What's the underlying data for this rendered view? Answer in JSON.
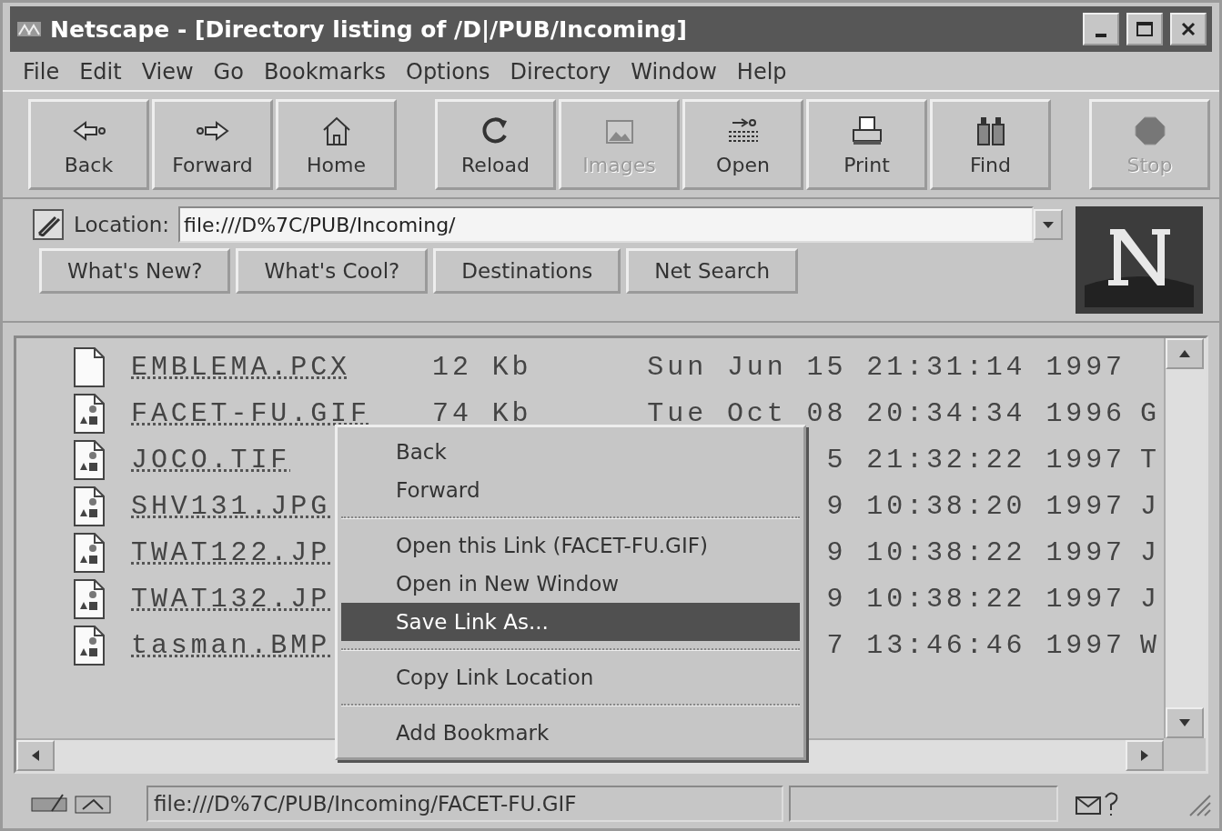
{
  "window": {
    "title": "Netscape - [Directory listing of /D|/PUB/Incoming]"
  },
  "menu_bar": [
    "File",
    "Edit",
    "View",
    "Go",
    "Bookmarks",
    "Options",
    "Directory",
    "Window",
    "Help"
  ],
  "toolbar": {
    "groups": [
      [
        {
          "kind": "back",
          "label": "Back",
          "disabled": false
        },
        {
          "kind": "forward",
          "label": "Forward",
          "disabled": false
        },
        {
          "kind": "home",
          "label": "Home",
          "disabled": false
        }
      ],
      [
        {
          "kind": "reload",
          "label": "Reload",
          "disabled": false
        },
        {
          "kind": "images",
          "label": "Images",
          "disabled": true
        },
        {
          "kind": "open",
          "label": "Open",
          "disabled": false
        },
        {
          "kind": "print",
          "label": "Print",
          "disabled": false
        },
        {
          "kind": "find",
          "label": "Find",
          "disabled": false
        }
      ],
      [
        {
          "kind": "stop",
          "label": "Stop",
          "disabled": true
        }
      ]
    ]
  },
  "location": {
    "label": "Location:",
    "value": "file:///D%7C/PUB/Incoming/"
  },
  "directory_buttons": [
    "What's New?",
    "What's Cool?",
    "Destinations",
    "Net Search"
  ],
  "listing": {
    "rows": [
      {
        "kind": "file",
        "name": "EMBLEMA.PCX",
        "size": "12 Kb",
        "modified": "Sun Jun 15 21:31:14 1997"
      },
      {
        "kind": "image",
        "name": "FACET-FU.GIF",
        "size": "74 Kb",
        "modified": "Tue Oct 08 20:34:34 1996",
        "type": "G"
      },
      {
        "kind": "image",
        "name": "JOCO.TIF",
        "modified": "5 21:32:22 1997",
        "type": "T"
      },
      {
        "kind": "image",
        "name": "SHV131.JPG",
        "modified": "9 10:38:20 1997",
        "type": "J"
      },
      {
        "kind": "image",
        "name": "TWAT122.JP",
        "modified": "9 10:38:22 1997",
        "type": "J"
      },
      {
        "kind": "image",
        "name": "TWAT132.JP",
        "modified": "9 10:38:22 1997",
        "type": "J"
      },
      {
        "kind": "image",
        "name": "tasman.BMP",
        "modified": "7 13:46:46 1997",
        "type": "W"
      }
    ]
  },
  "context_menu": {
    "groups": [
      [
        {
          "label": "Back",
          "selected": false
        },
        {
          "label": "Forward",
          "selected": false
        }
      ],
      [
        {
          "label": "Open this Link (FACET-FU.GIF)",
          "selected": false
        },
        {
          "label": "Open in New Window",
          "selected": false
        },
        {
          "label": "Save Link As...",
          "selected": true
        }
      ],
      [
        {
          "label": "Copy Link Location",
          "selected": false
        }
      ],
      [
        {
          "label": "Add Bookmark",
          "selected": false
        }
      ]
    ]
  },
  "status_bar": {
    "text": "file:///D%7C/PUB/Incoming/FACET-FU.GIF"
  }
}
